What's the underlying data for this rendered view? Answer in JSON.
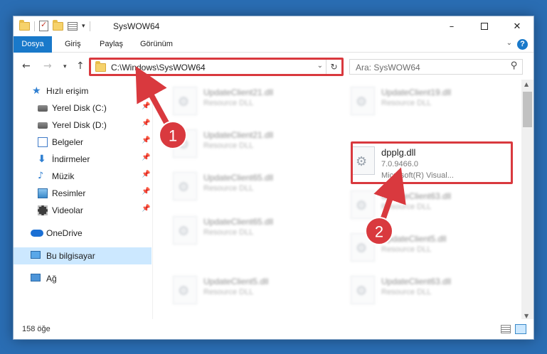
{
  "window": {
    "title": "SysWOW64",
    "minimize": "–",
    "close": "✕"
  },
  "ribbon": {
    "tabs": [
      "Dosya",
      "Giriş",
      "Paylaş",
      "Görünüm"
    ],
    "help": "?"
  },
  "navbar": {
    "address": "C:\\Windows\\SysWOW64",
    "search_placeholder": "Ara: SysWOW64"
  },
  "sidebar": {
    "items": [
      {
        "label": "Hızlı erişim",
        "icon": "star-icon"
      },
      {
        "label": "Yerel Disk (C:)",
        "icon": "disk-icon",
        "pinned": true
      },
      {
        "label": "Yerel Disk (D:)",
        "icon": "disk-icon",
        "pinned": true
      },
      {
        "label": "Belgeler",
        "icon": "document-icon",
        "pinned": true
      },
      {
        "label": "İndirmeler",
        "icon": "download-icon",
        "pinned": true
      },
      {
        "label": "Müzik",
        "icon": "music-icon",
        "pinned": true
      },
      {
        "label": "Resimler",
        "icon": "pictures-icon",
        "pinned": true
      },
      {
        "label": "Videolar",
        "icon": "videos-icon",
        "pinned": true
      },
      {
        "label": "OneDrive",
        "icon": "cloud-icon"
      },
      {
        "label": "Bu bilgisayar",
        "icon": "computer-icon",
        "selected": true
      },
      {
        "label": "Ağ",
        "icon": "network-icon"
      }
    ]
  },
  "files": [
    {
      "name": "UpdateClient21.dll",
      "type": "Resource DLL"
    },
    {
      "name": "UpdateClient19.dll",
      "type": "Resource DLL"
    },
    {
      "name": "UpdateClient21.dll",
      "type": "Resource DLL"
    },
    {
      "name": "dpplg.dll",
      "version": "7.0.9466.0",
      "description": "Microsoft(R) Visual..."
    },
    {
      "name": "UpdateClient65.dll",
      "type": "Resource DLL"
    },
    {
      "name": "UpdateClient63.dll",
      "type": "Resource DLL"
    },
    {
      "name": "UpdateClient65.dll",
      "type": "Resource DLL"
    },
    {
      "name": "UpdateClient5.dll",
      "type": "Resource DLL"
    },
    {
      "name": "UpdateClient5.dll",
      "type": "Resource DLL"
    },
    {
      "name": "UpdateClient63.dll",
      "type": "Resource DLL"
    }
  ],
  "status": {
    "count": "158 öğe"
  },
  "callouts": {
    "one": "1",
    "two": "2",
    "color": "#d9393e"
  }
}
